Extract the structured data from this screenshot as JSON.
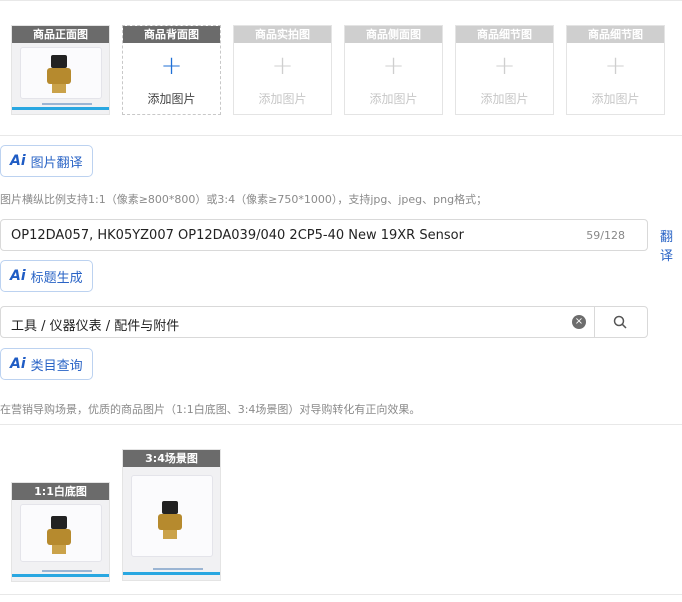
{
  "image_slots": [
    {
      "label": "商品正面图",
      "has_image": true
    },
    {
      "label": "商品背面图",
      "has_image": false,
      "active": true,
      "add_text": "添加图片"
    },
    {
      "label": "商品实拍图",
      "has_image": false,
      "add_text": "添加图片"
    },
    {
      "label": "商品侧面图",
      "has_image": false,
      "add_text": "添加图片"
    },
    {
      "label": "商品细节图",
      "has_image": false,
      "add_text": "添加图片"
    },
    {
      "label": "商品细节图",
      "has_image": false,
      "add_text": "添加图片"
    }
  ],
  "image_translate": {
    "ai": "Ai",
    "label": "图片翻译"
  },
  "image_hint": "图片横纵比例支持1:1（像素≥800*800）或3:4（像素≥750*1000），支持jpg、jpeg、png格式；",
  "title_input": {
    "value": "OP12DA057, HK05YZ007 OP12DA039/040 2CP5-40 New  19XR Sensor",
    "counter": "59/128"
  },
  "translate_link": "翻译",
  "title_generate": {
    "ai": "Ai",
    "label": "标题生成"
  },
  "category_input": {
    "value": "工具 / 仪器仪表 / 配件与附件"
  },
  "category_query": {
    "ai": "Ai",
    "label": "类目查询"
  },
  "scene_hint": "在营销导购场景，优质的商品图片（1:1白底图、3:4场景图）对导购转化有正向效果。",
  "scene_images": [
    {
      "label": "1:1白底图"
    },
    {
      "label": "3:4场景图"
    }
  ],
  "colors": {
    "accent": "#2a64c6",
    "label_bg": "#6b6b6b",
    "label_bg_disabled": "#cfcfcf"
  },
  "icons": {
    "plus": "plus-icon",
    "clear": "clear-icon",
    "search": "search-icon"
  }
}
